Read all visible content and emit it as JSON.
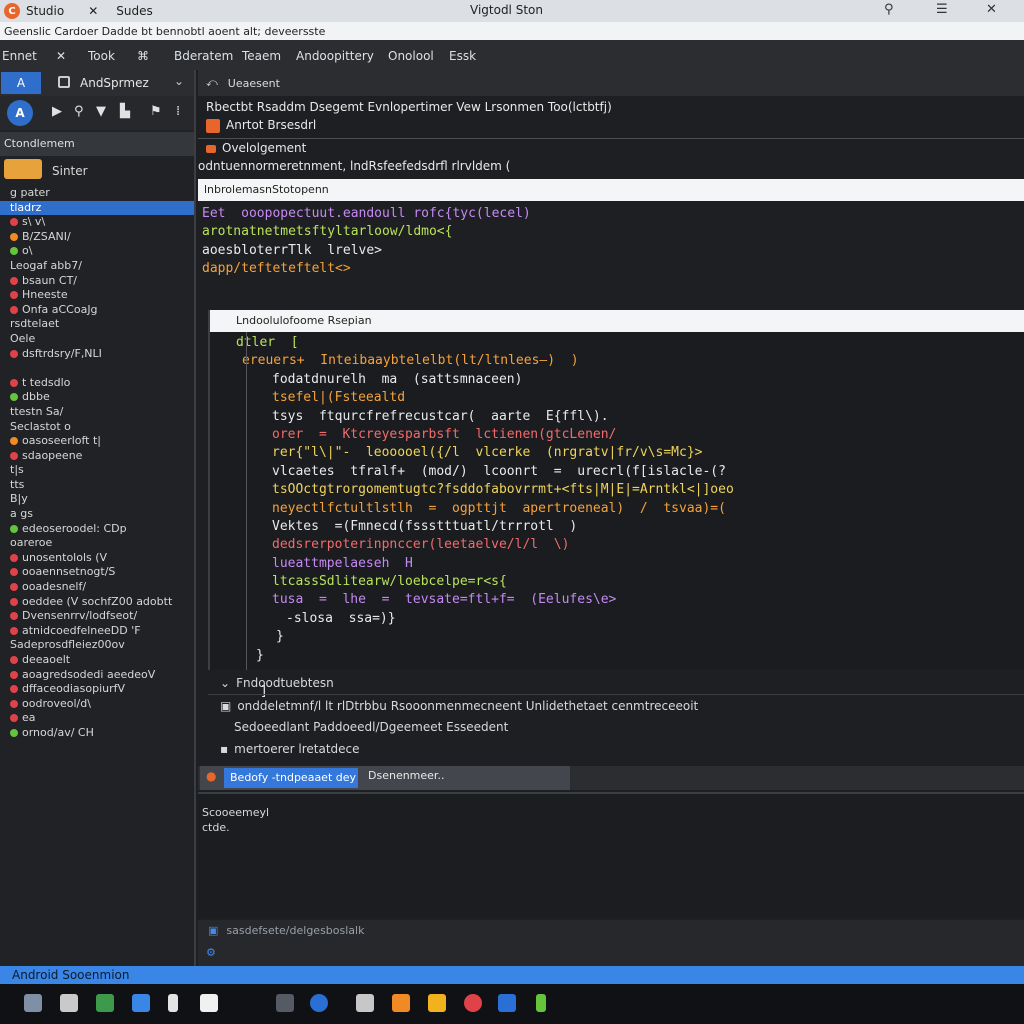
{
  "titlebar": {
    "tab1": "Studio",
    "close": "✕",
    "tab2": "Sudes",
    "window_title": "Vigtodl Ston",
    "ctrl_pin": "⚲",
    "ctrl_menu": "☰",
    "ctrl_close": "✕"
  },
  "pathbar": {
    "text": "Geenslic Cardoer Dadde bt bennobtl aoent alt; deveersste"
  },
  "menu": [
    "Ennet",
    "✕",
    "Took",
    "⌘",
    "Bderatem",
    "Teaem",
    "Andoopittery",
    "Onolool",
    "Essk"
  ],
  "sidebar": {
    "project_icon": "A",
    "project_label": "AndSprmez",
    "tool_main": "A",
    "tools": [
      "▶",
      "⚲",
      "▼",
      "▙",
      "⚑",
      "⁞"
    ],
    "section": "Ctondlemem",
    "starter": "Sinter",
    "items": [
      {
        "label": "g pater",
        "dot": "",
        "selected": false
      },
      {
        "label": "tladrz",
        "dot": "",
        "selected": true
      },
      {
        "label": "s\\ v\\",
        "dot": "red",
        "selected": false
      },
      {
        "label": "B/ZSANI/",
        "dot": "orange",
        "selected": false
      },
      {
        "label": "o\\",
        "dot": "green",
        "selected": false
      },
      {
        "label": "Leogaf abb7/",
        "dot": "",
        "selected": false
      },
      {
        "label": "bsaun    CT/",
        "dot": "red",
        "selected": false
      },
      {
        "label": "Hneeste",
        "dot": "red",
        "selected": false
      },
      {
        "label": "Onfa aCCoaJg",
        "dot": "red",
        "selected": false
      },
      {
        "label": "rsdtelaet",
        "dot": "",
        "selected": false
      },
      {
        "label": "Oele",
        "dot": "",
        "selected": false
      },
      {
        "label": "dsftrdsry/F,NLI",
        "dot": "red",
        "selected": false
      },
      {
        "label": "",
        "dot": "",
        "selected": false
      },
      {
        "label": "t tedsdlo",
        "dot": "red",
        "selected": false
      },
      {
        "label": "dbbe",
        "dot": "green",
        "selected": false
      },
      {
        "label": "ttestn   Sa/",
        "dot": "",
        "selected": false
      },
      {
        "label": "Seclastot o",
        "dot": "",
        "selected": false
      },
      {
        "label": "oasoseerloft  t|",
        "dot": "orange",
        "selected": false
      },
      {
        "label": "sdaopeene",
        "dot": "red",
        "selected": false
      },
      {
        "label": "t|s",
        "dot": "",
        "selected": false
      },
      {
        "label": "tts",
        "dot": "",
        "selected": false
      },
      {
        "label": "B|y",
        "dot": "",
        "selected": false
      },
      {
        "label": "a gs",
        "dot": "",
        "selected": false
      },
      {
        "label": "edeoseroodel: CDp",
        "dot": "green",
        "selected": false
      },
      {
        "label": "oareroe",
        "dot": "",
        "selected": false
      },
      {
        "label": "unosentolols  (V",
        "dot": "red",
        "selected": false
      },
      {
        "label": "ooaennsetnogt/S",
        "dot": "red",
        "selected": false
      },
      {
        "label": "ooadesnelf/",
        "dot": "red",
        "selected": false
      },
      {
        "label": "oeddee  (V  sochfZ00 adobtt",
        "dot": "red",
        "selected": false
      },
      {
        "label": "Dvensenrrv/lodfseot/",
        "dot": "red",
        "selected": false
      },
      {
        "label": "atnidcoedfelneeDD 'F",
        "dot": "red",
        "selected": false
      },
      {
        "label": "Sadeprosdfleiez00ov",
        "dot": "",
        "selected": false
      },
      {
        "label": "deeaoelt",
        "dot": "red",
        "selected": false
      },
      {
        "label": "aoagredsodedi aeedeoV",
        "dot": "red",
        "selected": false
      },
      {
        "label": "dffaceodiasopiurfV",
        "dot": "red",
        "selected": false
      },
      {
        "label": "oodroveol/d\\",
        "dot": "red",
        "selected": false
      },
      {
        "label": "ea",
        "dot": "red",
        "selected": false
      },
      {
        "label": "ornod/av/ CH",
        "dot": "green",
        "selected": false
      }
    ]
  },
  "main": {
    "header": "Ueaesent",
    "line1": "Rbectbt Rsaddm Dsegemt Evnlopertimer Vew Lrsonmen Too(lctbtfj)",
    "line2": "Anrtot Brsesdrl",
    "line3": "Ovelolgement",
    "line4": "odntuennormeretnment, lndRsfeefedsdrfl rlrvldem (",
    "search_bar": "lnbrolemasnStotopenn",
    "snippet": [
      {
        "text": "Eet  ooopopectuut.eandoull rofc{tyc(lecel)",
        "cls": "c-purple"
      },
      {
        "text": "arotnatnetmetsftyltarloow/ldmo<{",
        "cls": "c-green"
      },
      {
        "text": "aoesbloterrTlk  lrelve>",
        "cls": "c-white"
      },
      {
        "text": "dapp/tefteteftelt<>",
        "cls": "c-orange"
      }
    ],
    "editor_tab": "Lndoolulofoome Rsepian",
    "code": [
      {
        "text": "dtler  [",
        "cls": "c-green",
        "indent": 26
      },
      {
        "text": "ereuers+  Inteibaaybtelelbt(lt/ltnlees–)  )",
        "cls": "c-orange",
        "indent": 32
      },
      {
        "text": "fodatdnurelh  ma  (sattsmnaceen)",
        "cls": "c-white",
        "indent": 62
      },
      {
        "text": "tsefel|(Fsteealtd",
        "cls": "c-orange",
        "indent": 62
      },
      {
        "text": "tsys  ftqurcfrefrecustcar(  aarte  E{ffl\\).",
        "cls": "c-white",
        "indent": 62
      },
      {
        "text": "orer  =  Ktcreyesparbsft  lctienen(gtcLenen/",
        "cls": "c-red",
        "indent": 62
      },
      {
        "text": "rer{\"l\\|\"-  leooooel({/l  vlcerke  (nrgratv|fr/v\\s=Mc}>",
        "cls": "c-yellow",
        "indent": 62
      },
      {
        "text": "vlcaetes  tfralf+  (mod/)  lcoonrt  =  urecrl(f[islacle-(?",
        "cls": "c-white",
        "indent": 62
      },
      {
        "text": "tsOOctgtrorgomemtugtc?fsddofabovrrmt+<fts|M|E|=Arntkl<|]oeo",
        "cls": "c-yellow",
        "indent": 62
      },
      {
        "text": "neyectlfctultlstlh  =  ogpttjt  apertroeneal)  /  tsvaa)=(",
        "cls": "c-orange",
        "indent": 62
      },
      {
        "text": "Vektes  =(Fmnecd(fssstttuatl/trrrotl  )",
        "cls": "c-white",
        "indent": 62
      },
      {
        "text": "dedsrerpoterinpnccer(leetaelve/l/l  \\)",
        "cls": "c-red",
        "indent": 62
      },
      {
        "text": "lueattmpelaeseh  H",
        "cls": "c-purple",
        "indent": 62
      },
      {
        "text": "ltcassSdlitearw/loebcelpe=r<s{",
        "cls": "c-green",
        "indent": 62
      },
      {
        "text": "tusa  =  lhe  =  tevsate=ftl+f=  (Eelufes\\e>",
        "cls": "c-purple",
        "indent": 62
      },
      {
        "text": "-slosa  ssa=)}",
        "cls": "c-white",
        "indent": 76
      },
      {
        "text": "}",
        "cls": "c-white",
        "indent": 66
      },
      {
        "text": "}",
        "cls": "c-white",
        "indent": 46
      },
      {
        "text": "",
        "cls": "c-white",
        "indent": 46
      },
      {
        "text": "]",
        "cls": "c-white",
        "indent": 50
      }
    ],
    "lower": [
      "Fndoodtuebtesn",
      "onddeletmnf/l  lt  rlDtrbbu  Rsooonmenmecneent  Unlidethetaet  cenmtreceeoit",
      "Sedoeedlant  Paddoeedl/Dgeemeet  Esseedent",
      "mertoerer  lretatdece"
    ],
    "tab_seg": "Bedofy  -tndpeaaet dey",
    "tab_seg2": "Dsenenmeer..",
    "console_lines": [
      "Scooeemeyl",
      "ctde."
    ],
    "console_foot": "sasdefsete/delgesboslalk"
  },
  "statusbar": {
    "text": "Android Sooenmion"
  },
  "colors": {
    "accent": "#3a86e6",
    "brand_orange": "#e8662c",
    "editor_bg": "#1a1c20"
  }
}
